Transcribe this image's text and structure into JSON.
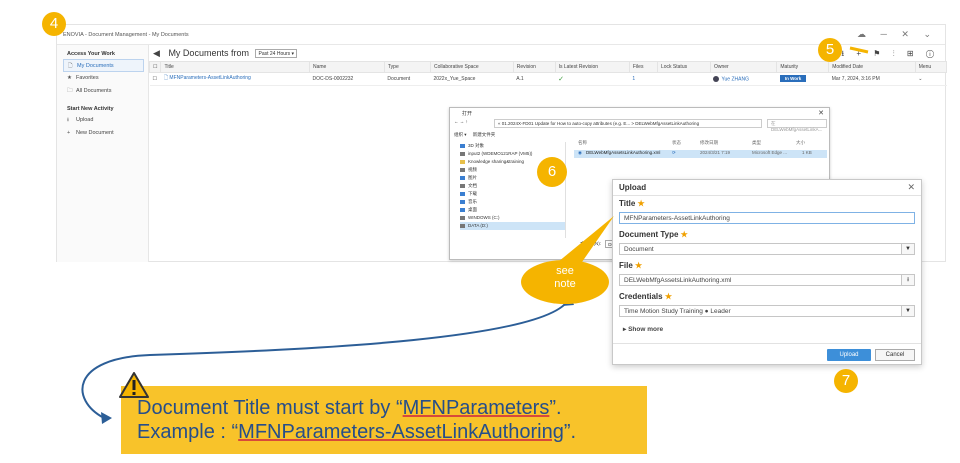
{
  "app": {
    "title": "ENOVIA - Document Management - My Documents",
    "top_icons": "☁ ─ ✕ ⌄"
  },
  "sidebar": {
    "section1": "Access Your Work",
    "items": [
      {
        "label": "My Documents",
        "icon": "document-icon",
        "glyph": "🗋"
      },
      {
        "label": "Favorites",
        "icon": "star-icon",
        "glyph": "★"
      },
      {
        "label": "All Documents",
        "icon": "folder-icon",
        "glyph": "🗀"
      }
    ],
    "section2": "Start New Activity",
    "actions": [
      {
        "label": "Upload",
        "icon": "upload-icon",
        "glyph": "⭳"
      },
      {
        "label": "New Document",
        "icon": "plus-icon",
        "glyph": "+"
      }
    ]
  },
  "main": {
    "heading": "My Documents from",
    "filter": "Past 24 Hours ▾",
    "tools": "⭳ + ⚑ ⫶ ⊞ ⓘ",
    "columns": [
      "Title",
      "Name",
      "Type",
      "Collaborative Space",
      "Revision",
      "Is Latest Revision",
      "Files",
      "Lock Status",
      "Owner",
      "Maturity",
      "Modified Date",
      "Menu"
    ],
    "rows": [
      {
        "title": "MFNParameters-AssetLinkAuthoring",
        "name": "DOC-DS-0002232",
        "type": "Document",
        "space": "2022x_Yue_Space",
        "revision": "A.1",
        "latest": "✓",
        "files": "1",
        "lock": "",
        "owner": "Yue ZHANG",
        "maturity": "In Work",
        "modified": "Mar 7, 2024, 3:16 PM",
        "menu": "⌄"
      }
    ]
  },
  "explorer": {
    "title": "打开",
    "path": "« 01.2024X-FD01 Update for How to auto-copy attributes (e.g. E...  >  DELWebMfgAssetLinkAuthoring",
    "search": "在 DELWebMfgAssetLinkA...",
    "toolbar": [
      "组织 ▾",
      "新建文件夹"
    ],
    "tree": [
      "3D 对象",
      "input2 (WDEMO121RAP (VM5))",
      "Knowledge sharing&training",
      "视频",
      "图片",
      "文档",
      "下载",
      "音乐",
      "桌面",
      "WINDOWS (C:)",
      "DATA (D:)"
    ],
    "columns": [
      "名称",
      "状态",
      "修改日期",
      "类型",
      "大小"
    ],
    "file": {
      "name": "DELWebMfgAssetsLinkAuthoring.xml",
      "status": "⟳",
      "date": "2024/3/21 7:19",
      "type": "Microsoft Edge ...",
      "size": "1 KB"
    },
    "filename_label": "文件名(N):",
    "filename_value": "DELWebMfgAssetsLinkAuthoring.xml"
  },
  "upload": {
    "title": "Upload",
    "title_label": "Title",
    "title_value": "MFNParameters-AssetLinkAuthoring",
    "doctype_label": "Document Type",
    "doctype_value": "Document",
    "file_label": "File",
    "file_value": "DELWebMfgAssetsLinkAuthoring.xml",
    "cred_label": "Credentials",
    "cred_value": "Time Motion Study Training ● Leader",
    "show_more": "Show more",
    "upload_btn": "Upload",
    "cancel_btn": "Cancel"
  },
  "steps": {
    "s4": "4",
    "s5": "5",
    "s6": "6",
    "s7": "7"
  },
  "callout": "see note",
  "note": {
    "line1_pre": "Document Title must start by “",
    "line1_u": "MFNParameters",
    "line1_post": "”.",
    "line2_pre": "Example : “",
    "line2_u": "MFNParameters-AssetLinkAuthoring",
    "line2_post": "”."
  },
  "colors": {
    "accent": "#2a6ebb",
    "step": "#f5b400",
    "note_bg": "#f8c32a",
    "note_text": "#264e8a"
  }
}
